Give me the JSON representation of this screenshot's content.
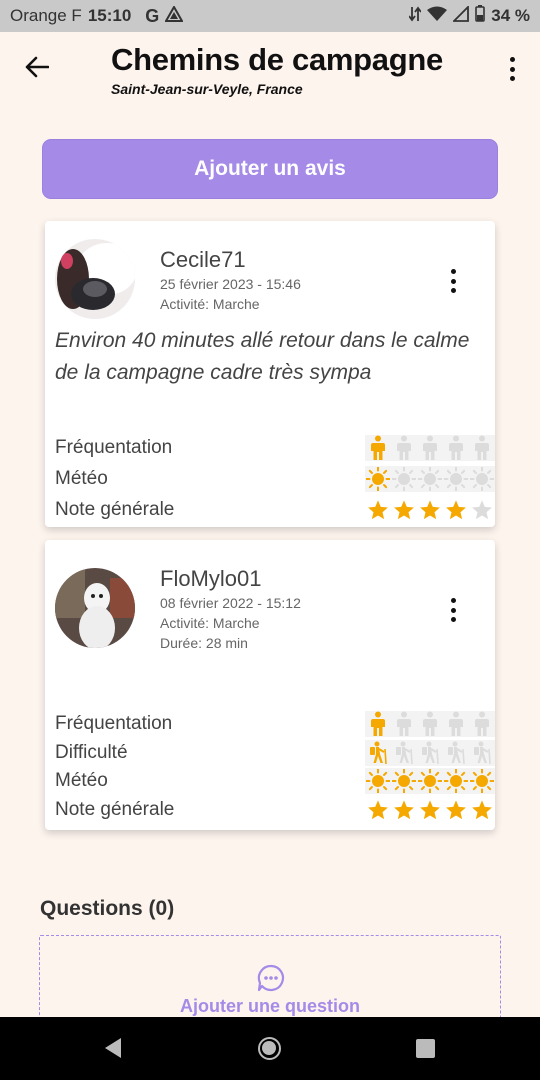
{
  "status": {
    "carrier": "Orange F",
    "time": "15:10",
    "g_icon": "G",
    "battery": "34 %"
  },
  "header": {
    "title": "Chemins de campagne",
    "subtitle": "Saint-Jean-sur-Veyle, France"
  },
  "add_review_label": "Ajouter un avis",
  "reviews": [
    {
      "user": "Cecile71",
      "date": "25 février 2023 - 15:46",
      "activity": "Activité: Marche",
      "comment": "Environ 40 minutes allé retour dans le calme de la campagne cadre très sympa",
      "ratings": [
        {
          "label": "Fréquentation",
          "icon": "person-icon",
          "value": 1,
          "max": 5
        },
        {
          "label": "Météo",
          "icon": "sun-icon",
          "value": 1,
          "max": 5
        },
        {
          "label": "Note générale",
          "icon": "star-icon",
          "value": 4,
          "max": 5
        }
      ]
    },
    {
      "user": "FloMylo01",
      "date": "08 février 2022 - 15:12",
      "activity": "Activité: Marche",
      "duration": "Durée: 28 min",
      "ratings": [
        {
          "label": "Fréquentation",
          "icon": "person-icon",
          "value": 1,
          "max": 5
        },
        {
          "label": "Difficulté",
          "icon": "hiker-icon",
          "value": 1,
          "max": 5
        },
        {
          "label": "Météo",
          "icon": "sun-icon",
          "value": 5,
          "max": 5
        },
        {
          "label": "Note générale",
          "icon": "star-icon",
          "value": 5,
          "max": 5
        }
      ]
    }
  ],
  "questions": {
    "title": "Questions (0)",
    "add_label": "Ajouter une question"
  },
  "colors": {
    "accent": "#a58ae8",
    "rating_on": "#f5a800",
    "rating_off": "#dcdcdc",
    "background": "#fdf4ee"
  }
}
